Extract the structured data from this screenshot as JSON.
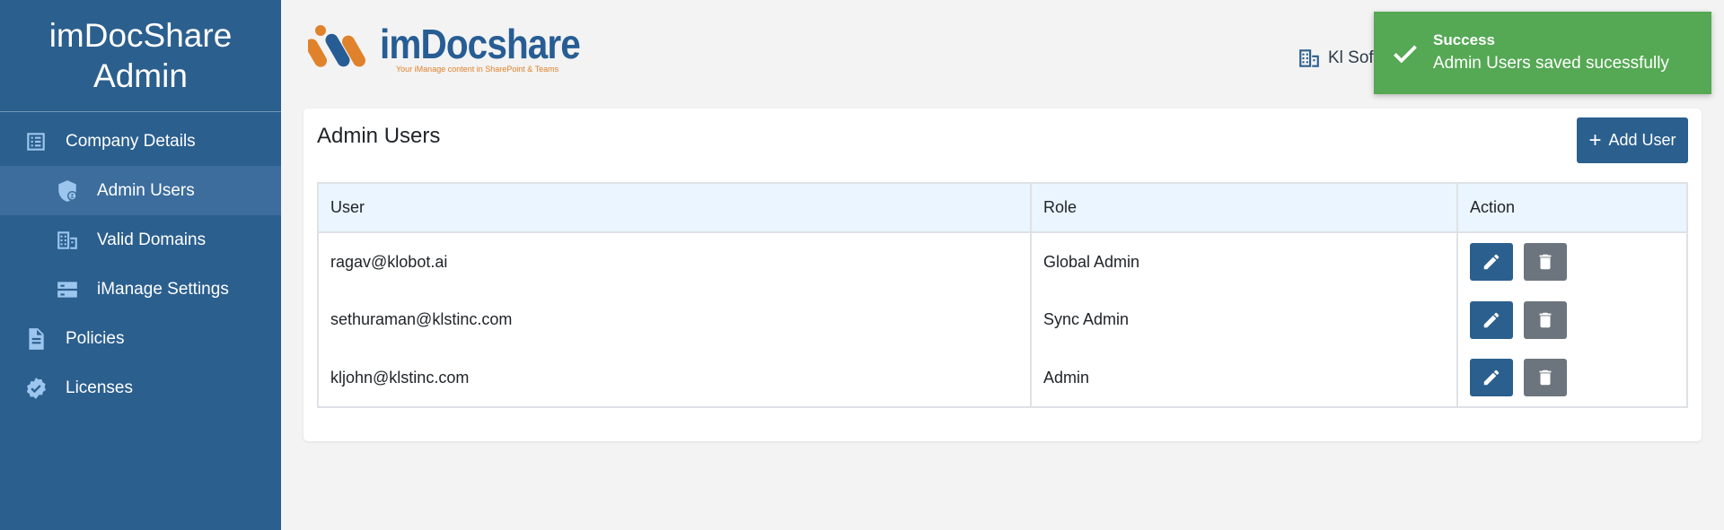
{
  "sidebar": {
    "title_line1": "imDocShare",
    "title_line2": "Admin",
    "items": [
      {
        "label": "Company Details",
        "icon": "list-icon"
      },
      {
        "label": "Admin Users",
        "icon": "shield-icon"
      },
      {
        "label": "Valid Domains",
        "icon": "building-icon"
      },
      {
        "label": "iManage Settings",
        "icon": "server-icon"
      },
      {
        "label": "Policies",
        "icon": "document-icon"
      },
      {
        "label": "Licenses",
        "icon": "badge-check-icon"
      }
    ]
  },
  "header": {
    "logo_name": "imDocshare",
    "logo_tagline": "Your iManage content in SharePoint & Teams",
    "tenant": "Kl Soft"
  },
  "toast": {
    "title": "Success",
    "message": "Admin Users saved sucessfully"
  },
  "card": {
    "title": "Admin Users",
    "add_label": "Add User"
  },
  "table": {
    "headers": [
      "User",
      "Role",
      "Action"
    ],
    "rows": [
      {
        "user": "ragav@klobot.ai",
        "role": "Global Admin"
      },
      {
        "user": "sethuraman@klstinc.com",
        "role": "Sync Admin"
      },
      {
        "user": "kljohn@klstinc.com",
        "role": "Admin"
      }
    ]
  },
  "colors": {
    "sidebar_bg": "#2b5f8e",
    "sidebar_active": "#3c6d9c",
    "primary": "#2b5f8e",
    "success": "#55a854",
    "secondary": "#6c757d",
    "table_header_bg": "#eaf5ff"
  }
}
